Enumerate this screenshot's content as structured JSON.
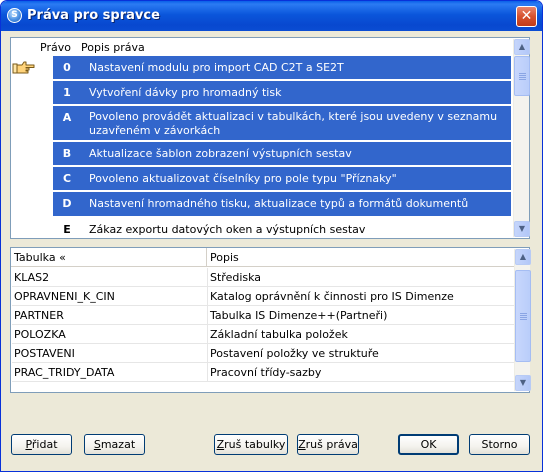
{
  "window": {
    "title": "Práva pro spravce",
    "app_icon_glyph": "S",
    "close_glyph": "✕"
  },
  "rights_table": {
    "headers": {
      "code": "Právo",
      "description": "Popis práva"
    },
    "rows": [
      {
        "code": "0",
        "description": "Nastavení modulu pro import CAD C2T a SE2T",
        "selected": true
      },
      {
        "code": "1",
        "description": "Vytvoření dávky pro hromadný tisk",
        "selected": true
      },
      {
        "code": "A",
        "description": "Povoleno provádět aktualizaci v  tabulkách, které jsou  uvedeny v seznamu uzavřeném v závorkách",
        "selected": true
      },
      {
        "code": "B",
        "description": "Aktualizace šablon zobrazení výstupních sestav",
        "selected": true
      },
      {
        "code": "C",
        "description": "Povoleno aktualizovat číselníky pro pole typu \"Příznaky\"",
        "selected": true
      },
      {
        "code": "D",
        "description": "Nastavení hromadného tisku, aktualizace typů a formátů dokumentů",
        "selected": true
      },
      {
        "code": "E",
        "description": "Zákaz exportu datových oken a výstupních sestav",
        "selected": false
      }
    ]
  },
  "tables_table": {
    "headers": {
      "table": "Tabulka «",
      "description": "Popis"
    },
    "rows": [
      {
        "table": "KLAS2",
        "description": "Střediska"
      },
      {
        "table": "OPRAVNENI_K_CIN",
        "description": "Katalog oprávnění k činnosti pro IS Dimenze"
      },
      {
        "table": "PARTNER",
        "description": "Tabulka IS Dimenze++(Partneři)"
      },
      {
        "table": "POLOZKA",
        "description": "Základní tabulka položek"
      },
      {
        "table": "POSTAVENI",
        "description": "Postavení položky ve struktuře"
      },
      {
        "table": "PRAC_TRIDY_DATA",
        "description": "Pracovní třídy-sazby"
      }
    ]
  },
  "buttons": {
    "add": {
      "accel": "P",
      "rest": "řidat"
    },
    "delete": {
      "accel": "S",
      "rest": "mazat"
    },
    "cancel_tables": {
      "accel": "Z",
      "rest": "ruš tabulky"
    },
    "cancel_rights": {
      "accel": "Z",
      "rest": "ruš práva"
    },
    "ok": "OK",
    "storno": "Storno"
  },
  "scroll": {
    "up_glyph": "▲",
    "down_glyph": "▼"
  },
  "colors": {
    "selection": "#3266cc",
    "titlebar": "#0a4dd3",
    "dialog_bg": "#ece9d8"
  }
}
